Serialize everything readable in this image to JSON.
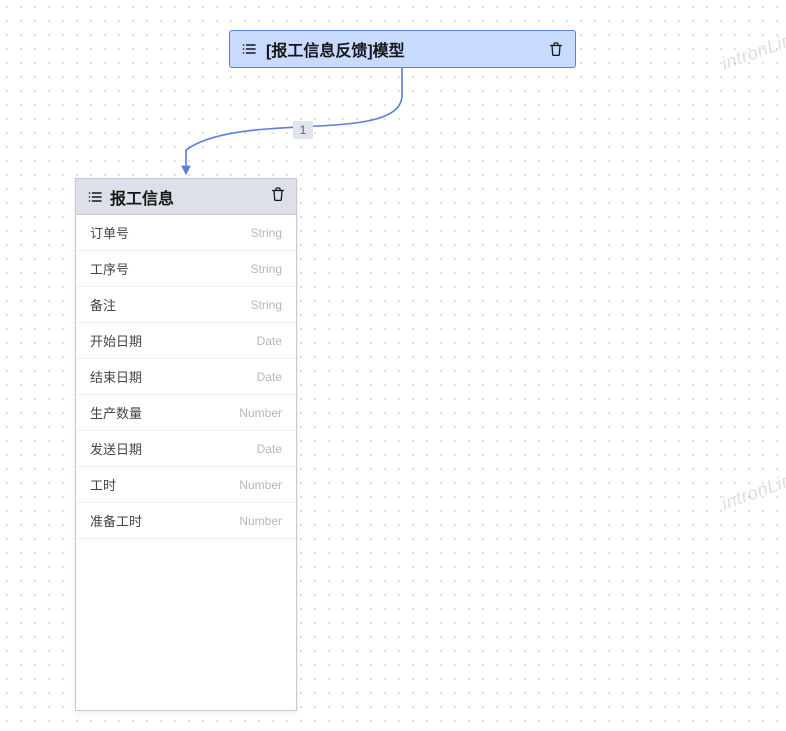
{
  "watermark_text": "intronLink",
  "root_node": {
    "title": "[报工信息反馈]模型"
  },
  "edge": {
    "label": "1"
  },
  "entity_node": {
    "title": "报工信息",
    "fields": [
      {
        "name": "订单号",
        "type": "String"
      },
      {
        "name": "工序号",
        "type": "String"
      },
      {
        "name": "备注",
        "type": "String"
      },
      {
        "name": "开始日期",
        "type": "Date"
      },
      {
        "name": "结束日期",
        "type": "Date"
      },
      {
        "name": "生产数量",
        "type": "Number"
      },
      {
        "name": "发送日期",
        "type": "Date"
      },
      {
        "name": "工时",
        "type": "Number"
      },
      {
        "name": "准备工时",
        "type": "Number"
      }
    ]
  }
}
